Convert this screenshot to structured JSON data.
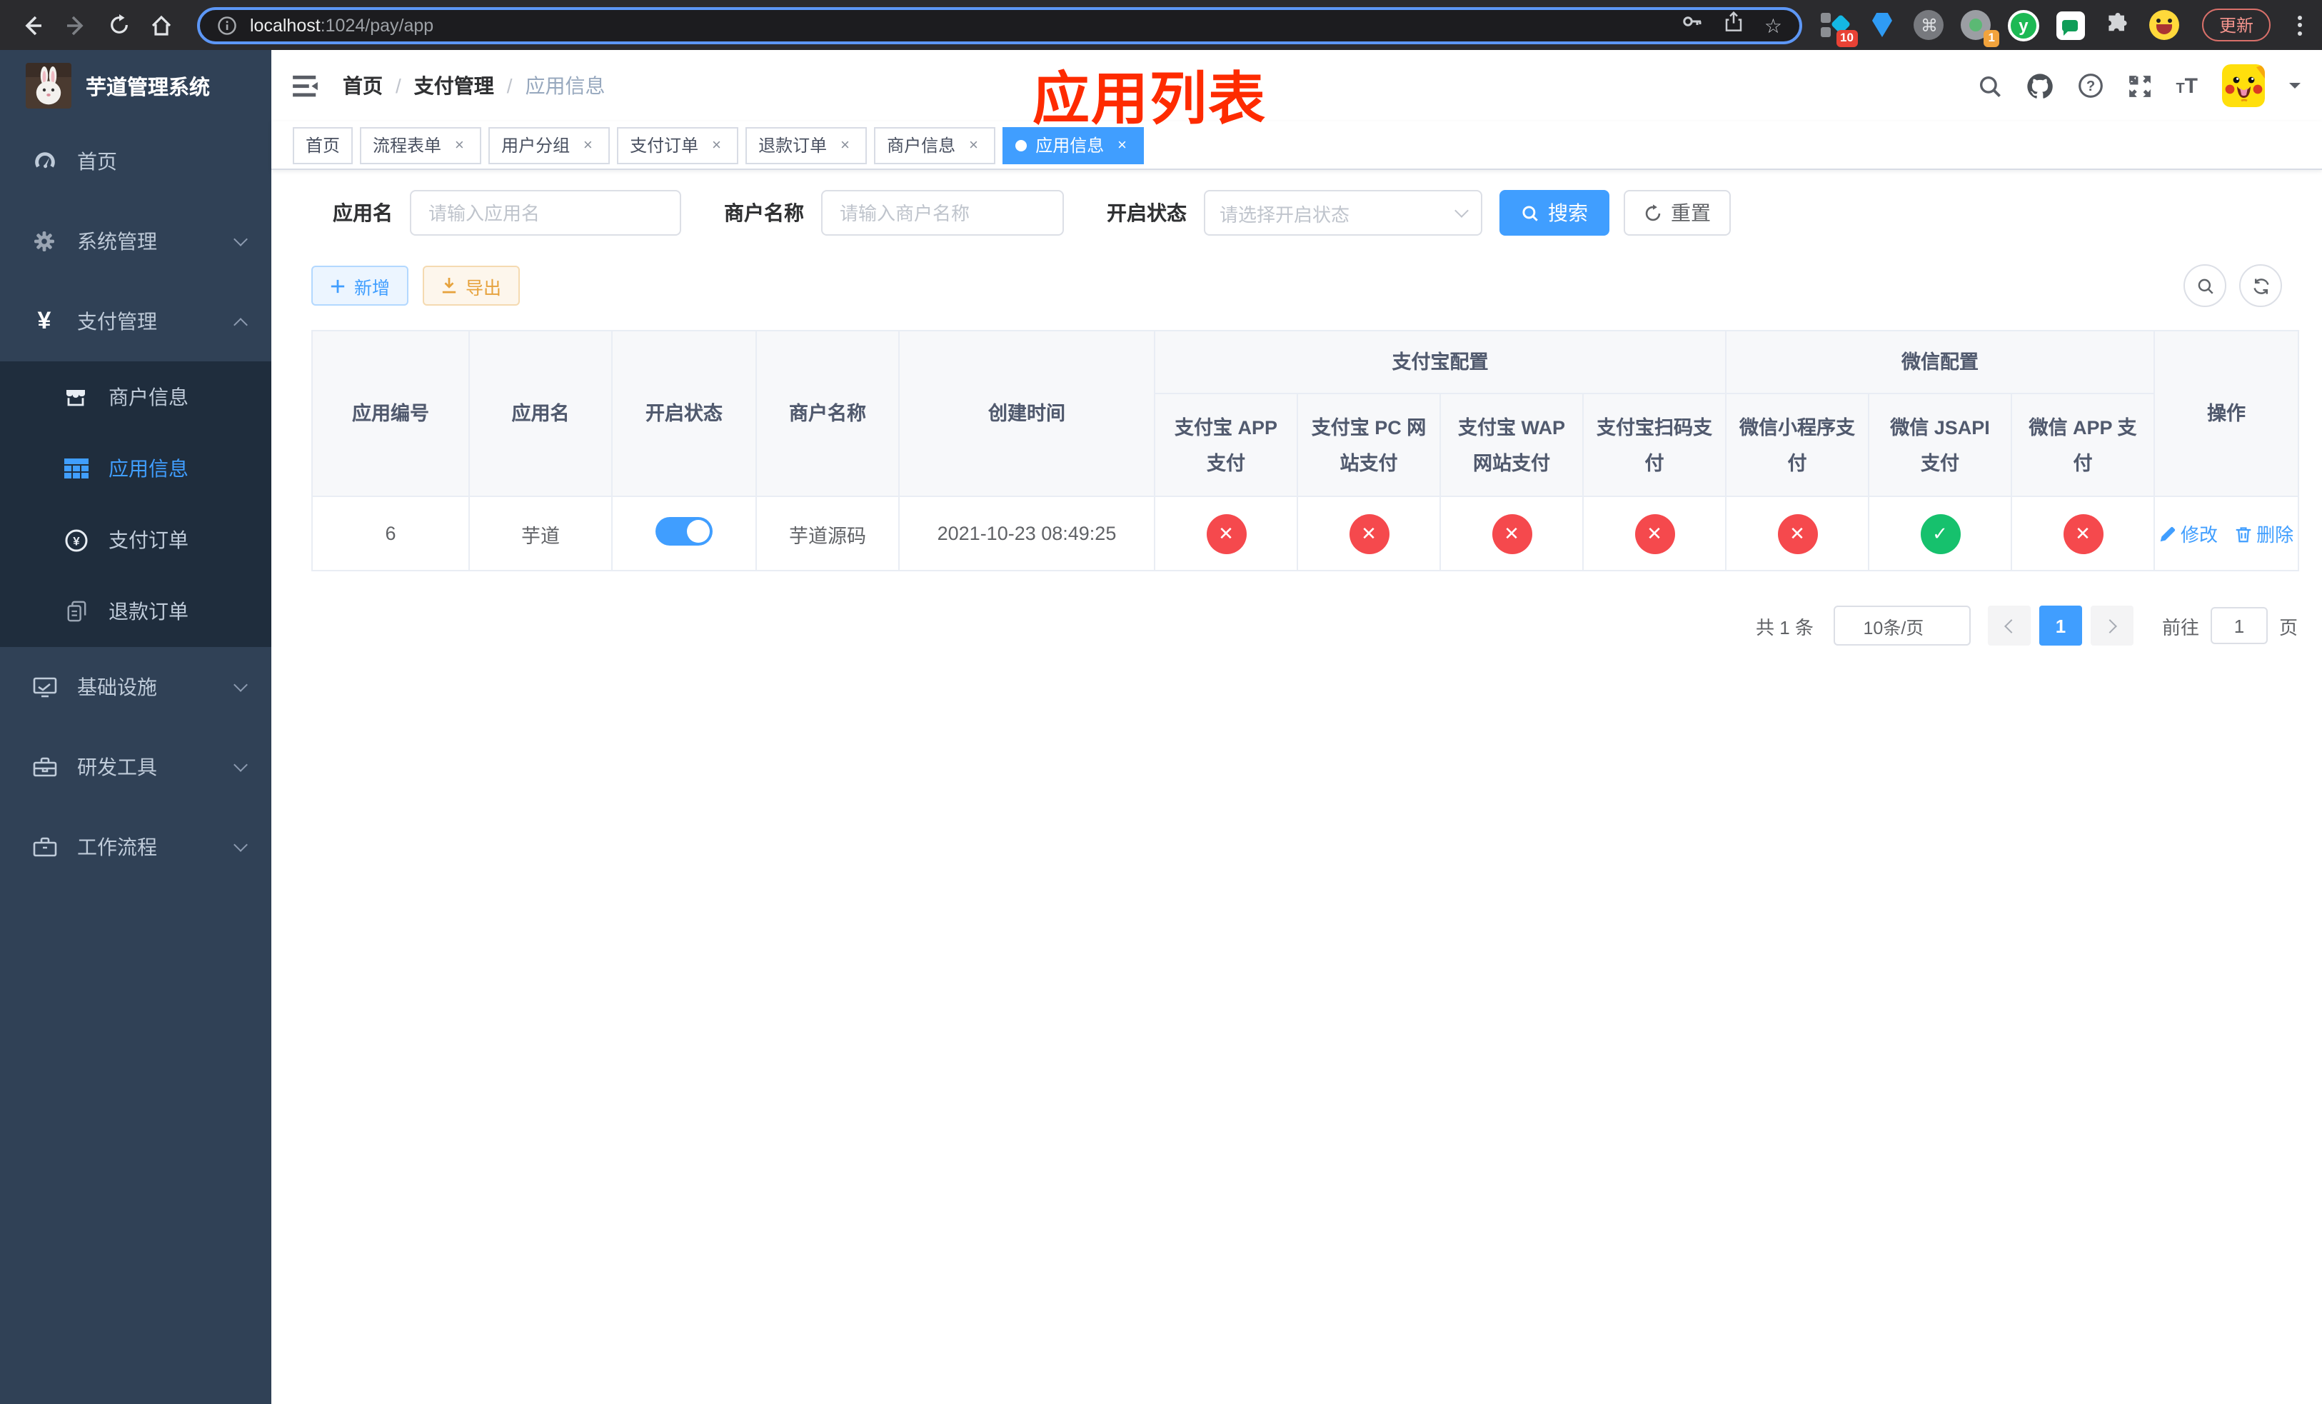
{
  "colors": {
    "accent": "#409eff",
    "sidebar_bg": "#304156",
    "submenu_bg": "#1f2d3d",
    "danger": "#f5494d",
    "success": "#16c16d",
    "warning": "#e6a23c",
    "annotation_red": "#fe2b00",
    "browser_bar": "#2b2b2e"
  },
  "browser": {
    "url_host": "localhost",
    "url_path": ":1024/pay/app",
    "ext_badge_tag": "10",
    "ext_badge_profile": "1",
    "ext_y_label": "y",
    "cmd_glyph": "⌘",
    "update_button": "更新"
  },
  "sidebar": {
    "title": "芋道管理系统",
    "items": [
      {
        "label": "首页"
      },
      {
        "label": "系统管理"
      },
      {
        "label": "支付管理"
      },
      {
        "label": "商户信息"
      },
      {
        "label": "应用信息"
      },
      {
        "label": "支付订单"
      },
      {
        "label": "退款订单"
      },
      {
        "label": "基础设施"
      },
      {
        "label": "研发工具"
      },
      {
        "label": "工作流程"
      }
    ]
  },
  "navbar": {
    "breadcrumb": [
      "首页",
      "支付管理",
      "应用信息"
    ],
    "overlay_title": "应用列表"
  },
  "tags": [
    {
      "label": "首页"
    },
    {
      "label": "流程表单"
    },
    {
      "label": "用户分组"
    },
    {
      "label": "支付订单"
    },
    {
      "label": "退款订单"
    },
    {
      "label": "商户信息"
    },
    {
      "label": "应用信息"
    }
  ],
  "filters": {
    "app_name_label": "应用名",
    "app_name_placeholder": "请输入应用名",
    "merchant_label": "商户名称",
    "merchant_placeholder": "请输入商户名称",
    "status_label": "开启状态",
    "status_placeholder": "请选择开启状态",
    "search_button": "搜索",
    "reset_button": "重置"
  },
  "toolbar": {
    "add_button": "新增",
    "export_button": "导出"
  },
  "table": {
    "group_headers": {
      "alipay": "支付宝配置",
      "wechat": "微信配置"
    },
    "columns": [
      "应用编号",
      "应用名",
      "开启状态",
      "商户名称",
      "创建时间",
      "支付宝 APP 支付",
      "支付宝 PC 网站支付",
      "支付宝 WAP 网站支付",
      "支付宝扫码支付",
      "微信小程序支付",
      "微信 JSAPI 支付",
      "微信 APP 支付",
      "操作"
    ],
    "rows": [
      {
        "id": "6",
        "name": "芋道",
        "enabled": true,
        "merchant": "芋道源码",
        "created_at": "2021-10-23 08:49:25",
        "channels": {
          "alipay_app": false,
          "alipay_pc": false,
          "alipay_wap": false,
          "alipay_qr": false,
          "wx_lite": false,
          "wx_jsapi": true,
          "wx_app": false
        },
        "actions": {
          "edit": "修改",
          "delete": "删除"
        }
      }
    ]
  },
  "pagination": {
    "total": "共 1 条",
    "page_size": "10条/页",
    "current_page": "1",
    "goto_label": "前往",
    "goto_value": "1",
    "page_suffix": "页"
  }
}
